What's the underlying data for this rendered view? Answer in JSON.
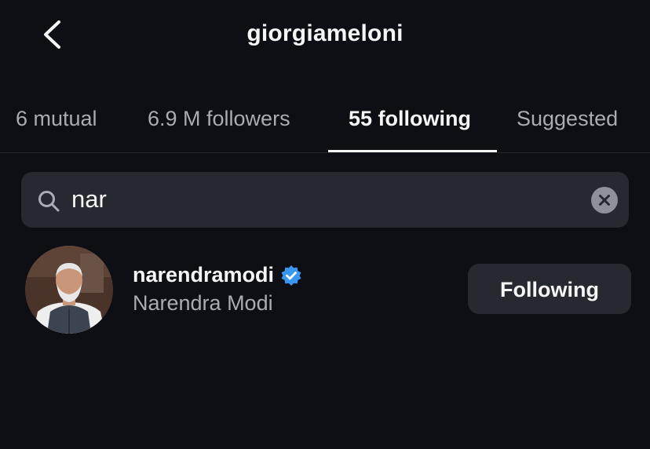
{
  "header": {
    "title": "giorgiameloni",
    "back_icon": "chevron-left-icon"
  },
  "tabs": [
    {
      "label": "6 mutual",
      "active": false
    },
    {
      "label": "6.9 M followers",
      "active": false
    },
    {
      "label": "55 following",
      "active": true
    },
    {
      "label": "Suggested",
      "active": false
    }
  ],
  "search": {
    "value": "nar",
    "icon": "search-icon",
    "clear_icon": "clear-icon"
  },
  "results": [
    {
      "username": "narendramodi",
      "full_name": "Narendra Modi",
      "verified": true,
      "button_label": "Following"
    }
  ],
  "colors": {
    "background": "#0d0f14",
    "surface": "#26292f",
    "text_primary": "#f5f5f5",
    "text_secondary": "#a8acb3",
    "verified_blue": "#3897f0"
  }
}
